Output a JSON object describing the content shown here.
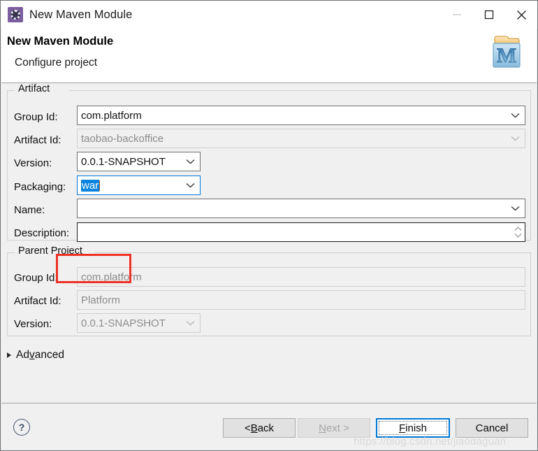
{
  "window": {
    "title": "New Maven Module",
    "icon": "maven-wizard-icon",
    "controls": {
      "minimize": "minimize-icon",
      "maximize": "maximize-icon",
      "close": "close-icon"
    }
  },
  "banner": {
    "title": "New Maven Module",
    "subtitle": "Configure project",
    "logo": "maven-folder-m-icon"
  },
  "artifact": {
    "legend": "Artifact",
    "group_id": {
      "label": "Group Id:",
      "value": "com.platform",
      "enabled": true
    },
    "artifact_id": {
      "label": "Artifact Id:",
      "value": "taobao-backoffice",
      "enabled": false
    },
    "version": {
      "label": "Version:",
      "value": "0.0.1-SNAPSHOT",
      "enabled": true
    },
    "packaging": {
      "label": "Packaging:",
      "value": "war",
      "enabled": true,
      "focused": true,
      "selected": true
    },
    "name": {
      "label": "Name:",
      "value": "",
      "enabled": true
    },
    "description": {
      "label": "Description:",
      "value": "",
      "enabled": true
    }
  },
  "parent_project": {
    "legend": "Parent Project",
    "group_id": {
      "label": "Group Id:",
      "value": "com.platform",
      "enabled": false
    },
    "artifact_id": {
      "label": "Artifact Id:",
      "value": "Platform",
      "enabled": false
    },
    "version": {
      "label": "Version:",
      "value": "0.0.1-SNAPSHOT",
      "enabled": false
    }
  },
  "advanced": {
    "label_pre": "Ad",
    "label_mnemonic": "v",
    "label_post": "anced",
    "expanded": false
  },
  "footer": {
    "help": "?",
    "buttons": {
      "back": {
        "pre": "< ",
        "mnemonic": "B",
        "post": "ack",
        "enabled": true,
        "default": false
      },
      "next": {
        "pre": "",
        "mnemonic": "N",
        "post": "ext >",
        "enabled": false,
        "default": false
      },
      "finish": {
        "pre": "",
        "mnemonic": "F",
        "post": "inish",
        "enabled": true,
        "default": true
      },
      "cancel": {
        "pre": "Cancel",
        "mnemonic": "",
        "post": "",
        "enabled": true,
        "default": false
      }
    }
  },
  "watermark": "https://blog.csdn.net/jiaodaguan",
  "colors": {
    "accent": "#0078d7",
    "selection": "#0a84e0",
    "annotation": "#ee3124",
    "dialog_bg": "#f0f0f0",
    "header_bg": "#ffffff"
  }
}
